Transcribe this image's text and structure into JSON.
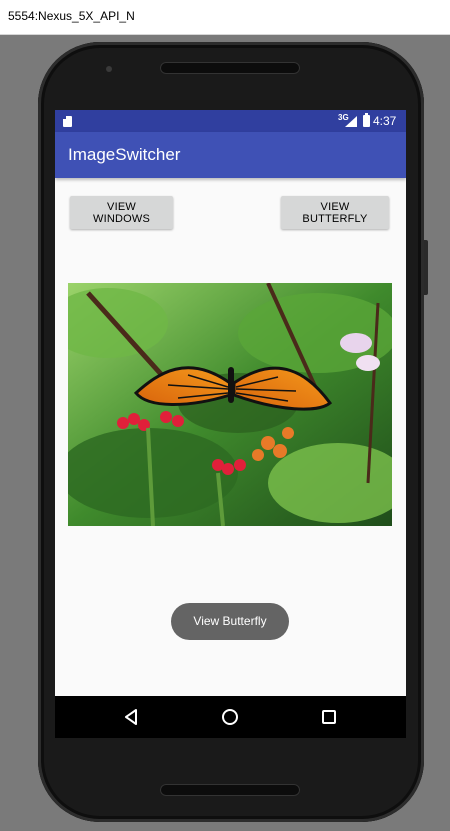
{
  "emulator": {
    "title": "5554:Nexus_5X_API_N"
  },
  "status_bar": {
    "network_label": "3G",
    "time": "4:37",
    "color": "#303f9f"
  },
  "app_bar": {
    "title": "ImageSwitcher",
    "color": "#3f51b5"
  },
  "buttons": {
    "view_windows": "VIEW WINDOWS",
    "view_butterfly": "VIEW BUTTERFLY"
  },
  "image": {
    "icon": "butterfly-image"
  },
  "toast": {
    "message": "View Butterfly"
  },
  "nav_bar": {
    "back_icon": "back-triangle-icon",
    "home_icon": "home-circle-icon",
    "recents_icon": "recents-square-icon"
  }
}
